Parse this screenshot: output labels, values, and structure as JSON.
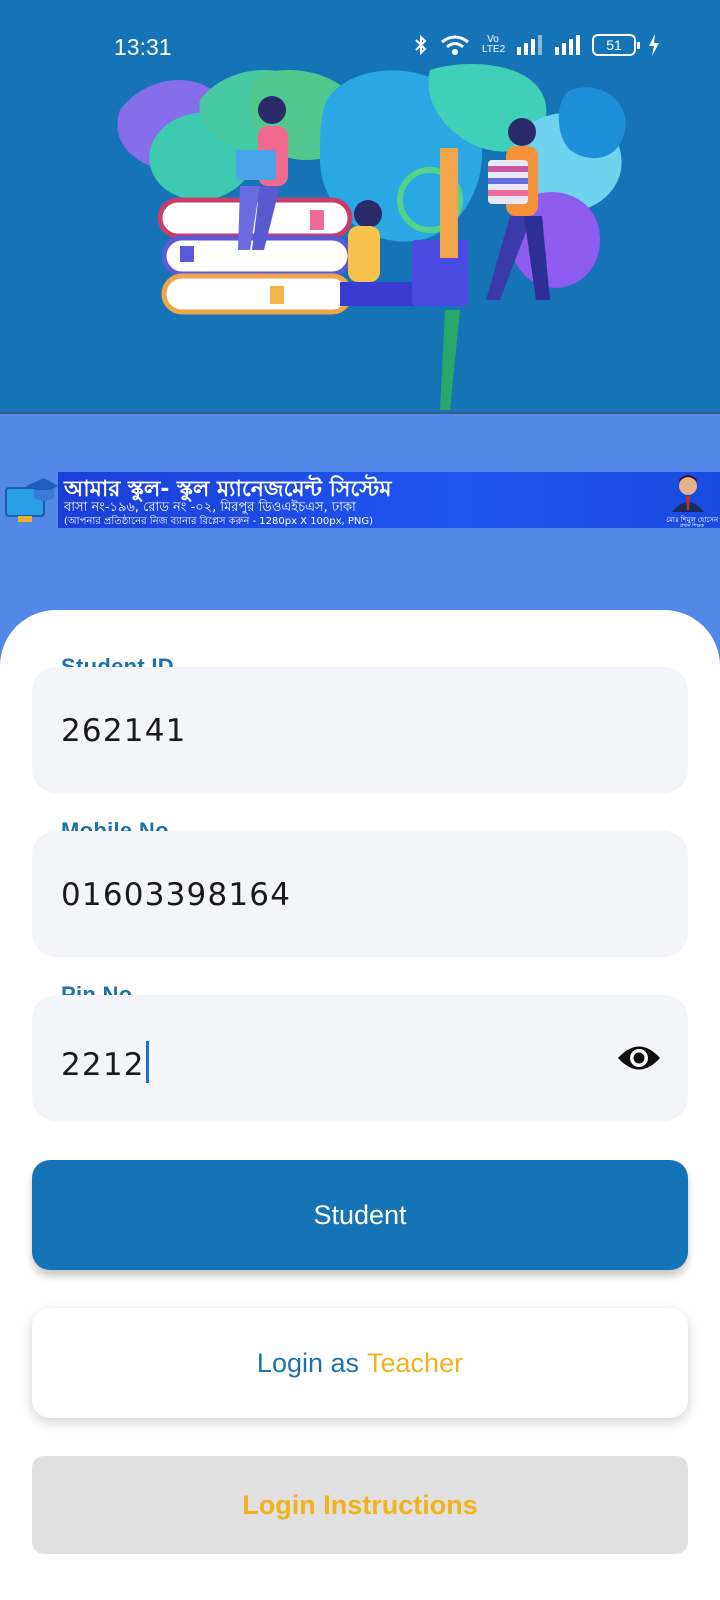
{
  "status_bar": {
    "time": "13:31",
    "network_label": "Vo LTE2",
    "battery": "51",
    "icons": [
      "bluetooth-icon",
      "wifi-icon",
      "volte-icon",
      "signal-icon",
      "signal-icon",
      "battery-icon",
      "charging-icon"
    ]
  },
  "banner": {
    "title": "আমার স্কুল- স্কুল ম্যানেজমেন্ট সিস্টেম",
    "address": "বাসা নং-১৯৬, রোড নং -০২, মিরপুর ডিওএইচএস, ঢাকা",
    "note": "(আপনার প্রতিষ্ঠানের নিজ ব্যানার  রিপ্লেস করুন - 1280px X 100px, PNG)",
    "person_name": "মোঃ শিমুল হোসেন",
    "person_role": "প্রধান শিক্ষক"
  },
  "form": {
    "student_id": {
      "label": "Student ID",
      "value": "262141"
    },
    "mobile": {
      "label": "Mobile No.",
      "value": "01603398164"
    },
    "pin": {
      "label": "Pin No.",
      "value": "2212"
    }
  },
  "buttons": {
    "primary": "Student",
    "teacher_prefix": "Login as",
    "teacher_highlight": "Teacher",
    "instructions": "Login Instructions"
  },
  "colors": {
    "hero_bg": "#1673b5",
    "page_bg": "#5289e6",
    "primary": "#1673b5",
    "accent": "#f2b21d",
    "label": "#1d72ac"
  }
}
